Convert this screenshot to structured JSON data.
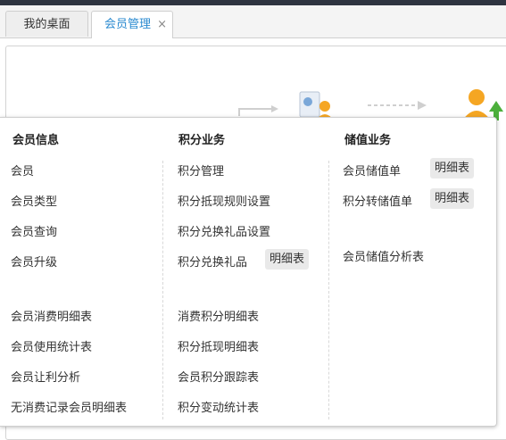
{
  "tabs": [
    {
      "label": "我的桌面",
      "active": false
    },
    {
      "label": "会员管理",
      "active": true,
      "close_glyph": "×"
    }
  ],
  "menu": {
    "columns": [
      {
        "heading": "会员信息",
        "items": [
          "会员",
          "会员类型",
          "会员查询",
          "会员升级",
          "会员消费明细表",
          "会员使用统计表",
          "会员让利分析",
          "无消费记录会员明细表"
        ]
      },
      {
        "heading": "积分业务",
        "items": [
          "积分管理",
          "积分抵现规则设置",
          "积分兑换礼品设置",
          "积分兑换礼品",
          "消费积分明细表",
          "积分抵现明细表",
          "会员积分跟踪表",
          "积分变动统计表"
        ],
        "badges": {
          "积分兑换礼品": "明细表"
        }
      },
      {
        "heading": "储值业务",
        "items": [
          "会员储值单",
          "积分转储值单",
          "会员储值分析表"
        ],
        "badges": {
          "会员储值单": "明细表",
          "积分转储值单": "明细表"
        }
      }
    ]
  },
  "colors": {
    "active_tab_text": "#2a8ad0",
    "topbar": "#2e3440"
  }
}
